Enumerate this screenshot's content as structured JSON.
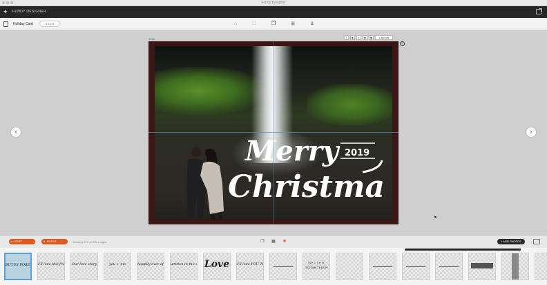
{
  "window": {
    "title": "Fundy Designer"
  },
  "app": {
    "name": "FUNDY DESIGNER"
  },
  "project": {
    "name": "Holiday Card",
    "size": "5.5 x 8"
  },
  "card": {
    "side_label": "Front",
    "tool_icons": [
      "T",
      "■",
      "◐",
      "■",
      "◉"
    ],
    "layouts_label": "Layouts",
    "greeting_line1": "Merry",
    "greeting_line2": "Christmas",
    "greeting_year": "2019"
  },
  "controls": {
    "sort_label": "SORT",
    "filter_label": "FILTER",
    "showing_text": "Showing 279 of 279 images",
    "add_photos_label": "+ ADD PHOTOS"
  },
  "colors": {
    "accent": "#e05a1d",
    "card_border": "#3a1716"
  },
  "thumbnails": [
    {
      "text": "BUTUS  FOREVER",
      "style": "script"
    },
    {
      "text": "I'll love this friend",
      "style": "script"
    },
    {
      "text": "Our love story",
      "style": "script"
    },
    {
      "text": "you + me",
      "style": "script"
    },
    {
      "text": "happily ever after",
      "style": "script"
    },
    {
      "text": "written in the stars",
      "style": "script"
    },
    {
      "text": "Love",
      "style": "big"
    },
    {
      "text": "I'll love YOU TO the",
      "style": "script"
    },
    {
      "text": "",
      "style": "line"
    },
    {
      "text": "BETTER TOGETHER",
      "style": "block"
    },
    {
      "text": "",
      "style": "blank"
    },
    {
      "text": "",
      "style": "line"
    },
    {
      "text": "",
      "style": "line"
    },
    {
      "text": "",
      "style": "line"
    },
    {
      "text": "",
      "style": "bar"
    },
    {
      "text": "",
      "style": "vbar"
    },
    {
      "text": "",
      "style": "blank"
    }
  ]
}
